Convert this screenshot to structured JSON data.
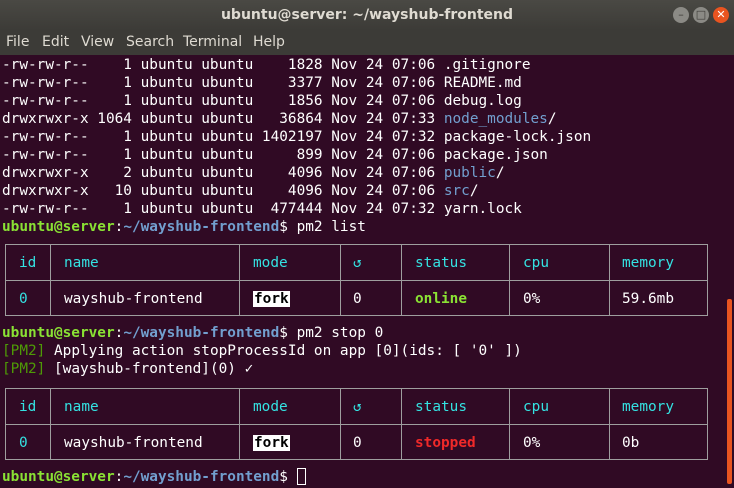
{
  "window": {
    "title": "ubuntu@server: ~/wayshub-frontend",
    "minimize_glyph": "–",
    "maximize_glyph": "□",
    "close_glyph": "✕"
  },
  "menu": [
    "File",
    "Edit",
    "View",
    "Search",
    "Terminal",
    "Help"
  ],
  "listing": [
    {
      "meta": "-rw-rw-r--    1 ubuntu ubuntu    1828 Nov 24 07:06 ",
      "name": ".gitignore",
      "is_dir": false,
      "suffix": ""
    },
    {
      "meta": "-rw-rw-r--    1 ubuntu ubuntu    3377 Nov 24 07:06 ",
      "name": "README.md",
      "is_dir": false,
      "suffix": ""
    },
    {
      "meta": "-rw-rw-r--    1 ubuntu ubuntu    1856 Nov 24 07:06 ",
      "name": "debug.log",
      "is_dir": false,
      "suffix": ""
    },
    {
      "meta": "drwxrwxr-x 1064 ubuntu ubuntu   36864 Nov 24 07:33 ",
      "name": "node_modules",
      "is_dir": true,
      "suffix": "/"
    },
    {
      "meta": "-rw-rw-r--    1 ubuntu ubuntu 1402197 Nov 24 07:32 ",
      "name": "package-lock.json",
      "is_dir": false,
      "suffix": ""
    },
    {
      "meta": "-rw-rw-r--    1 ubuntu ubuntu     899 Nov 24 07:06 ",
      "name": "package.json",
      "is_dir": false,
      "suffix": ""
    },
    {
      "meta": "drwxrwxr-x    2 ubuntu ubuntu    4096 Nov 24 07:06 ",
      "name": "public",
      "is_dir": true,
      "suffix": "/"
    },
    {
      "meta": "drwxrwxr-x   10 ubuntu ubuntu    4096 Nov 24 07:06 ",
      "name": "src",
      "is_dir": true,
      "suffix": "/"
    },
    {
      "meta": "-rw-rw-r--    1 ubuntu ubuntu  477444 Nov 24 07:32 ",
      "name": "yarn.lock",
      "is_dir": false,
      "suffix": ""
    }
  ],
  "prompt": {
    "user": "ubuntu@server",
    "colon": ":",
    "path": "~/wayshub-frontend",
    "symbol": "$ "
  },
  "commands": {
    "first": "pm2 list",
    "second": "pm2 stop 0"
  },
  "pm2_output": [
    {
      "tag": "[PM2]",
      "text": " Applying action stopProcessId on app [0](ids: [ '0' ])"
    },
    {
      "tag": "[PM2]",
      "text": " [wayshub-frontend](0) ✓"
    }
  ],
  "table_headers": [
    "id",
    "name",
    "mode",
    "↺",
    "status",
    "cpu",
    "memory"
  ],
  "table1_row": {
    "id": "0",
    "name": "wayshub-frontend",
    "mode": "fork",
    "restarts": "0",
    "status": "online",
    "cpu": "0%",
    "memory": "59.6mb"
  },
  "table2_row": {
    "id": "0",
    "name": "wayshub-frontend",
    "mode": "fork",
    "restarts": "0",
    "status": "stopped",
    "cpu": "0%",
    "memory": "0b"
  },
  "colors": {
    "background": "#300a24",
    "prompt_user": "#8ae234",
    "prompt_path": "#729fcf",
    "header": "#34e2e2",
    "online": "#8ae234",
    "stopped": "#ef2929",
    "scroll_thumb": "#e95420"
  }
}
